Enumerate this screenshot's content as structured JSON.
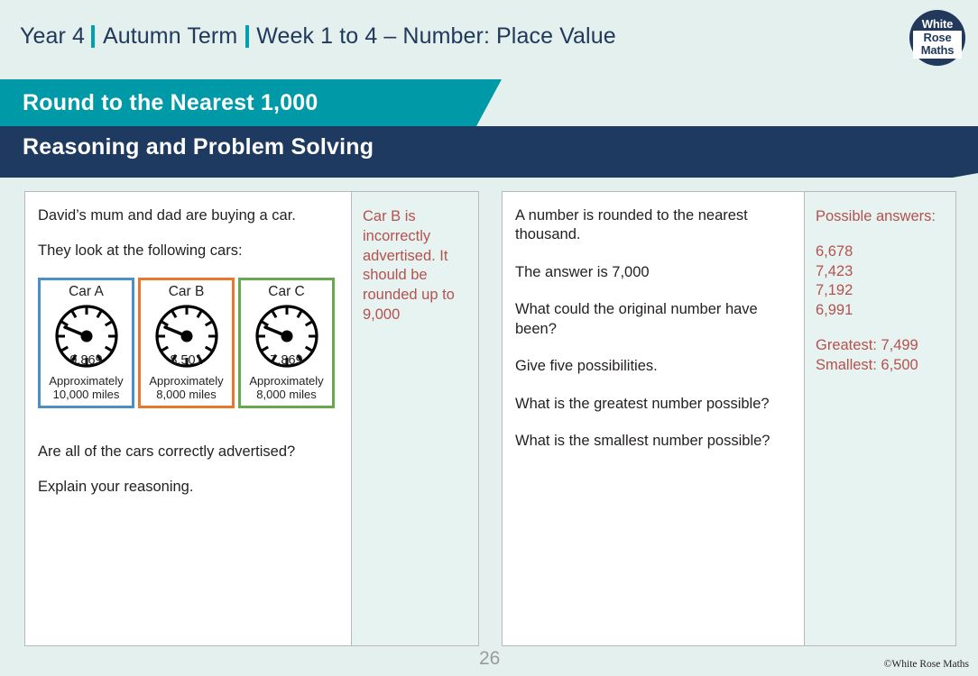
{
  "header": {
    "year": "Year 4",
    "term": "Autumn Term",
    "week": "Week 1 to 4 – Number: Place Value",
    "teal_accent": "#0099a8",
    "navy": "#1f3a60"
  },
  "logo": {
    "line1": "White",
    "line2": "Rose",
    "line3": "Maths"
  },
  "banners": {
    "topic": "Round to the Nearest 1,000",
    "section": "Reasoning and Problem Solving"
  },
  "panel1": {
    "question": {
      "line1": "David’s mum and dad are buying a car.",
      "line2": "They look at the following cars:",
      "line3": "Are all of the cars correctly advertised?",
      "line4": "Explain your reasoning."
    },
    "cars": [
      {
        "name": "Car A",
        "reading": "9,869",
        "approx_line1": "Approximately",
        "approx_line2": "10,000 miles",
        "border_color": "#4a90c4"
      },
      {
        "name": "Car B",
        "reading": "8,501",
        "approx_line1": "Approximately",
        "approx_line2": "8,000 miles",
        "border_color": "#e8772e"
      },
      {
        "name": "Car C",
        "reading": "7,869",
        "approx_line1": "Approximately",
        "approx_line2": "8,000 miles",
        "border_color": "#6aa84f"
      }
    ],
    "answer": {
      "text": "Car B is incorrectly advertised. It should be rounded up to 9,000",
      "color": "#b4524f"
    }
  },
  "panel2": {
    "question": {
      "line1": "A number is rounded to the nearest thousand.",
      "line2": "The answer is 7,000",
      "line3": "What could the original number have been?",
      "line4": "Give five possibilities.",
      "line5": "What is the greatest number possible?",
      "line6": "What is the smallest number possible?"
    },
    "answer": {
      "heading": "Possible answers:",
      "values": [
        "6,678",
        "7,423",
        "7,192",
        "6,991"
      ],
      "greatest": "Greatest: 7,499",
      "smallest": "Smallest: 6,500",
      "color": "#b4524f"
    }
  },
  "footer": {
    "page_number": "26",
    "copyright": "©White Rose Maths"
  }
}
